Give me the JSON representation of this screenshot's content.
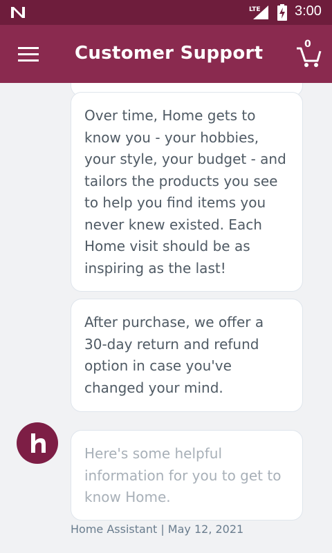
{
  "status_bar": {
    "time": "3:00",
    "network": "LTE",
    "icons": [
      "n-icon",
      "lte-signal-icon",
      "battery-charging-icon"
    ]
  },
  "app_bar": {
    "title": "Customer Support",
    "cart_count": "0",
    "icons": [
      "menu-icon",
      "cart-icon"
    ]
  },
  "messages": [
    {
      "text": ""
    },
    {
      "text": "Over time, Home gets to know you - your hobbies, your style, your budget - and tailors the products you see to help you find items you never knew existed. Each Home visit should be as inspiring as the last!"
    },
    {
      "text": "After purchase, we offer a 30-day return and refund option in case you've changed your mind."
    },
    {
      "text": "Here's some helpful information for you to get to know Home."
    }
  ],
  "meta": {
    "sender_date": "Home Assistant | May 12, 2021"
  },
  "colors": {
    "status_bar": "#6e1d3c",
    "app_bar": "#8a2a4f",
    "avatar": "#7d1e45",
    "background": "#f1f2f4"
  }
}
